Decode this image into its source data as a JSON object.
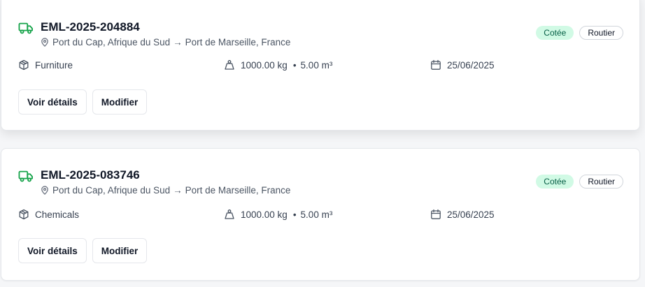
{
  "shipments": [
    {
      "reference": "EML-2025-204884",
      "origin": "Port du Cap, Afrique du Sud",
      "arrow": "→",
      "destination": "Port de Marseille, France",
      "status": "Cotée",
      "mode": "Routier",
      "category": "Furniture",
      "weight": "1000.00 kg",
      "separator": "•",
      "volume": "5.00 m³",
      "date": "25/06/2025",
      "actions": {
        "details": "Voir détails",
        "edit": "Modifier"
      }
    },
    {
      "reference": "EML-2025-083746",
      "origin": "Port du Cap, Afrique du Sud",
      "arrow": "→",
      "destination": "Port de Marseille, France",
      "status": "Cotée",
      "mode": "Routier",
      "category": "Chemicals",
      "weight": "1000.00 kg",
      "separator": "•",
      "volume": "5.00 m³",
      "date": "25/06/2025",
      "actions": {
        "details": "Voir détails",
        "edit": "Modifier"
      }
    }
  ],
  "colors": {
    "truck_icon": "#16a34a",
    "status_badge_bg": "#d1fae5",
    "status_badge_text": "#065f46"
  }
}
